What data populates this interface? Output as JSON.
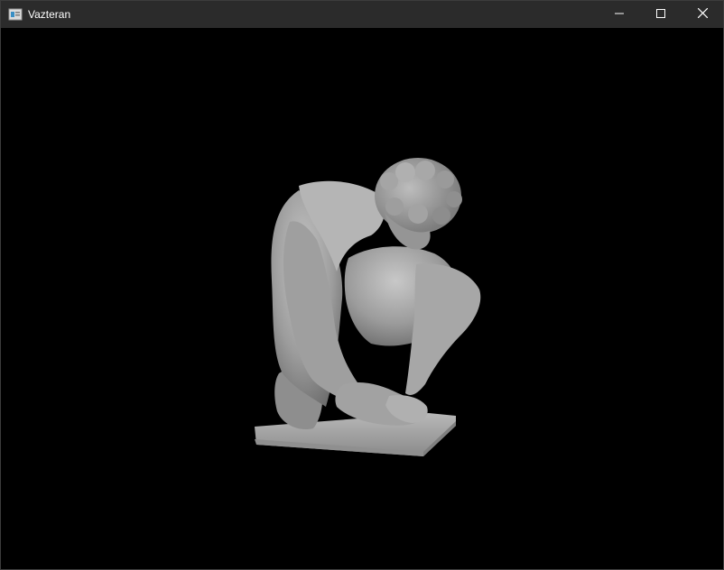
{
  "window": {
    "title": "Vazteran"
  },
  "viewport": {
    "background": "#000000",
    "model": {
      "name": "crouching-boy-statue",
      "color": "#9a9a9a"
    }
  },
  "icons": {
    "app": "app-window-icon",
    "minimize": "minimize-icon",
    "maximize": "maximize-icon",
    "close": "close-icon"
  }
}
